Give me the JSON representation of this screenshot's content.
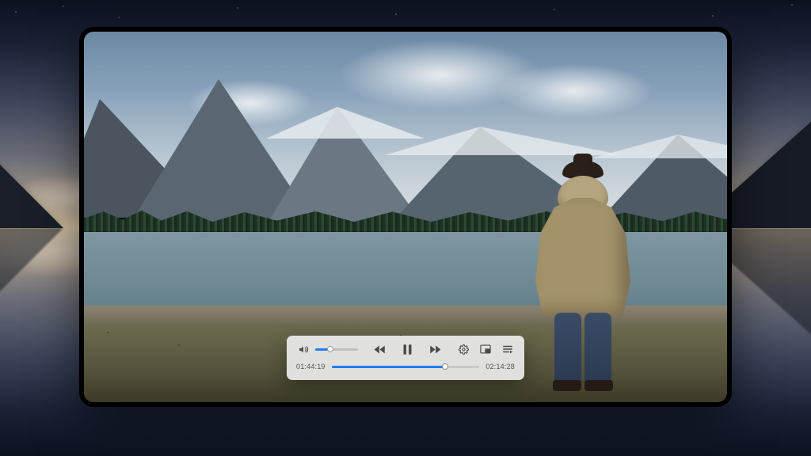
{
  "player": {
    "accent_color": "#1f7df1",
    "volume_percent": 35,
    "progress_percent": 77,
    "current_time": "01:44:19",
    "total_time": "02:14:28",
    "state": "playing",
    "icons": {
      "volume": "volume-icon",
      "rewind": "skip-back-icon",
      "play_pause": "pause-icon",
      "forward": "skip-forward-icon",
      "settings": "gear-icon",
      "pip": "picture-in-picture-icon",
      "playlist": "playlist-icon"
    }
  }
}
